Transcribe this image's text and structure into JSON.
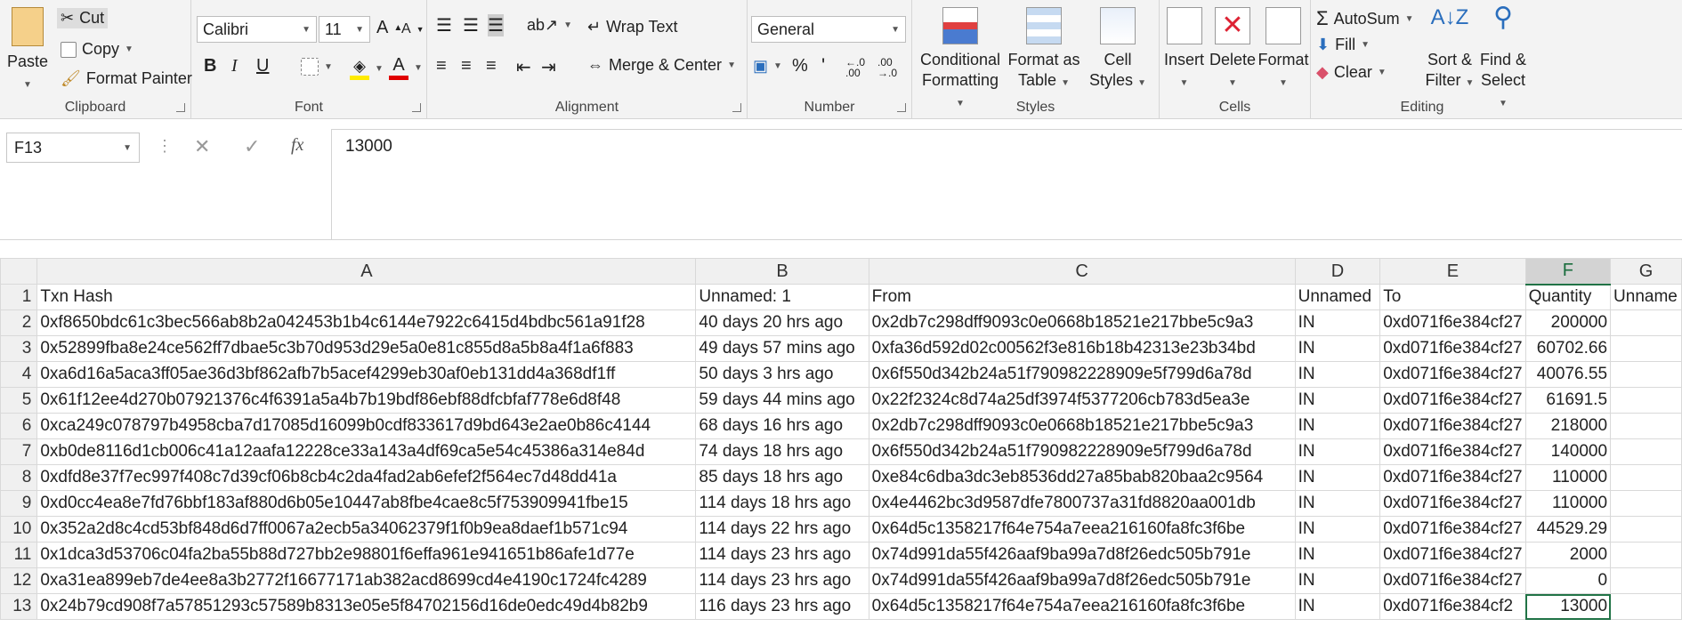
{
  "ribbon": {
    "clipboard": {
      "paste": "Paste",
      "cut": "Cut",
      "copy": "Copy",
      "format_painter": "Format Painter",
      "label": "Clipboard"
    },
    "font": {
      "name": "Calibri",
      "size": "11",
      "bold": "B",
      "italic": "I",
      "underline": "U",
      "label": "Font"
    },
    "alignment": {
      "wrap": "Wrap Text",
      "merge": "Merge & Center",
      "label": "Alignment"
    },
    "number": {
      "format": "General",
      "percent": "%",
      "comma": "'",
      "label": "Number"
    },
    "styles": {
      "conditional": "Conditional",
      "conditional2": "Formatting",
      "format_table": "Format as",
      "format_table2": "Table",
      "cell_styles": "Cell",
      "cell_styles2": "Styles",
      "label": "Styles"
    },
    "cells": {
      "insert": "Insert",
      "delete": "Delete",
      "format": "Format",
      "label": "Cells"
    },
    "editing": {
      "autosum": "AutoSum",
      "fill": "Fill",
      "clear": "Clear",
      "sort": "Sort &",
      "sort2": "Filter",
      "find": "Find &",
      "find2": "Select",
      "label": "Editing"
    }
  },
  "formula_bar": {
    "name_box": "F13",
    "fx": "fx",
    "value": "13000"
  },
  "sheet": {
    "columns": [
      "A",
      "B",
      "C",
      "D",
      "E",
      "F",
      "G"
    ],
    "selected_column": "F",
    "active_cell": "F13",
    "rows": [
      {
        "n": "1",
        "a": "Txn Hash",
        "b": "Unnamed: 1",
        "c": "From",
        "d": "Unnamed",
        "e": "To",
        "f": "Quantity",
        "g": "Unname"
      },
      {
        "n": "2",
        "a": "0xf8650bdc61c3bec566ab8b2a042453b1b4c6144e7922c6415d4bdbc561a91f28",
        "b": "40 days 20 hrs ago",
        "c": "0x2db7c298dff9093c0e0668b18521e217bbe5c9a3",
        "d": "IN",
        "e": "0xd071f6e384cf27",
        "f": "200000",
        "g": ""
      },
      {
        "n": "3",
        "a": "0x52899fba8e24ce562ff7dbae5c3b70d953d29e5a0e81c855d8a5b8a4f1a6f883",
        "b": "49 days 57 mins ago",
        "c": "0xfa36d592d02c00562f3e816b18b42313e23b34bd",
        "d": "IN",
        "e": "0xd071f6e384cf27",
        "f": "60702.66",
        "g": ""
      },
      {
        "n": "4",
        "a": "0xa6d16a5aca3ff05ae36d3bf862afb7b5acef4299eb30af0eb131dd4a368df1ff",
        "b": "50 days 3 hrs ago",
        "c": "0x6f550d342b24a51f790982228909e5f799d6a78d",
        "d": "IN",
        "e": "0xd071f6e384cf27",
        "f": "40076.55",
        "g": ""
      },
      {
        "n": "5",
        "a": "0x61f12ee4d270b07921376c4f6391a5a4b7b19bdf86ebf88dfcbfaf778e6d8f48",
        "b": "59 days 44 mins ago",
        "c": "0x22f2324c8d74a25df3974f5377206cb783d5ea3e",
        "d": "IN",
        "e": "0xd071f6e384cf27",
        "f": "61691.5",
        "g": ""
      },
      {
        "n": "6",
        "a": "0xca249c078797b4958cba7d17085d16099b0cdf833617d9bd643e2ae0b86c4144",
        "b": "68 days 16 hrs ago",
        "c": "0x2db7c298dff9093c0e0668b18521e217bbe5c9a3",
        "d": "IN",
        "e": "0xd071f6e384cf27",
        "f": "218000",
        "g": ""
      },
      {
        "n": "7",
        "a": "0xb0de8116d1cb006c41a12aafa12228ce33a143a4df69ca5e54c45386a314e84d",
        "b": "74 days 18 hrs ago",
        "c": "0x6f550d342b24a51f790982228909e5f799d6a78d",
        "d": "IN",
        "e": "0xd071f6e384cf27",
        "f": "140000",
        "g": ""
      },
      {
        "n": "8",
        "a": "0xdfd8e37f7ec997f408c7d39cf06b8cb4c2da4fad2ab6efef2f564ec7d48dd41a",
        "b": "85 days 18 hrs ago",
        "c": "0xe84c6dba3dc3eb8536dd27a85bab820baa2c9564",
        "d": "IN",
        "e": "0xd071f6e384cf27",
        "f": "110000",
        "g": ""
      },
      {
        "n": "9",
        "a": "0xd0cc4ea8e7fd76bbf183af880d6b05e10447ab8fbe4cae8c5f753909941fbe15",
        "b": "114 days 18 hrs ago",
        "c": "0x4e4462bc3d9587dfe7800737a31fd8820aa001db",
        "d": "IN",
        "e": "0xd071f6e384cf27",
        "f": "110000",
        "g": ""
      },
      {
        "n": "10",
        "a": "0x352a2d8c4cd53bf848d6d7ff0067a2ecb5a34062379f1f0b9ea8daef1b571c94",
        "b": "114 days 22 hrs ago",
        "c": "0x64d5c1358217f64e754a7eea216160fa8fc3f6be",
        "d": "IN",
        "e": "0xd071f6e384cf27",
        "f": "44529.29",
        "g": ""
      },
      {
        "n": "11",
        "a": "0x1dca3d53706c04fa2ba55b88d727bb2e98801f6effa961e941651b86afe1d77e",
        "b": "114 days 23 hrs ago",
        "c": "0x74d991da55f426aaf9ba99a7d8f26edc505b791e",
        "d": "IN",
        "e": "0xd071f6e384cf27",
        "f": "2000",
        "g": ""
      },
      {
        "n": "12",
        "a": "0xa31ea899eb7de4ee8a3b2772f16677171ab382acd8699cd4e4190c1724fc4289",
        "b": "114 days 23 hrs ago",
        "c": "0x74d991da55f426aaf9ba99a7d8f26edc505b791e",
        "d": "IN",
        "e": "0xd071f6e384cf27",
        "f": "0",
        "g": ""
      },
      {
        "n": "13",
        "a": "0x24b79cd908f7a57851293c57589b8313e05e5f84702156d16de0edc49d4b82b9",
        "b": "116 days 23 hrs ago",
        "c": "0x64d5c1358217f64e754a7eea216160fa8fc3f6be",
        "d": "IN",
        "e": "0xd071f6e384cf2",
        "f": "13000",
        "g": ""
      }
    ]
  }
}
